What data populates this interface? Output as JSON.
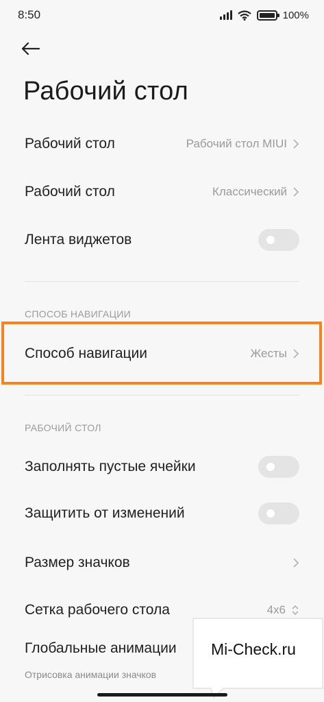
{
  "status": {
    "time": "8:50",
    "battery": "100%"
  },
  "page": {
    "title": "Рабочий стол"
  },
  "rows_top": [
    {
      "label": "Рабочий стол",
      "value": "Рабочий стол MIUI"
    },
    {
      "label": "Рабочий стол",
      "value": "Классический"
    },
    {
      "label": "Лента виджетов",
      "toggle": false
    }
  ],
  "nav_section": {
    "header": "СПОСОБ НАВИГАЦИИ",
    "row": {
      "label": "Способ навигации",
      "value": "Жесты"
    }
  },
  "desktop_section": {
    "header": "РАБОЧИЙ СТОЛ",
    "rows": [
      {
        "label": "Заполнять пустые ячейки",
        "toggle": false
      },
      {
        "label": "Защитить от изменений",
        "toggle": false
      },
      {
        "label": "Размер значков"
      },
      {
        "label": "Сетка рабочего стола",
        "value": "4x6"
      },
      {
        "label": "Глобальные анимации",
        "sub": "Отрисовка анимации значков",
        "toggle": true
      }
    ]
  },
  "watermark": {
    "text": "Mi-Check.ru"
  },
  "colors": {
    "accent": "#0d84ff",
    "highlight": "#f5841f"
  }
}
